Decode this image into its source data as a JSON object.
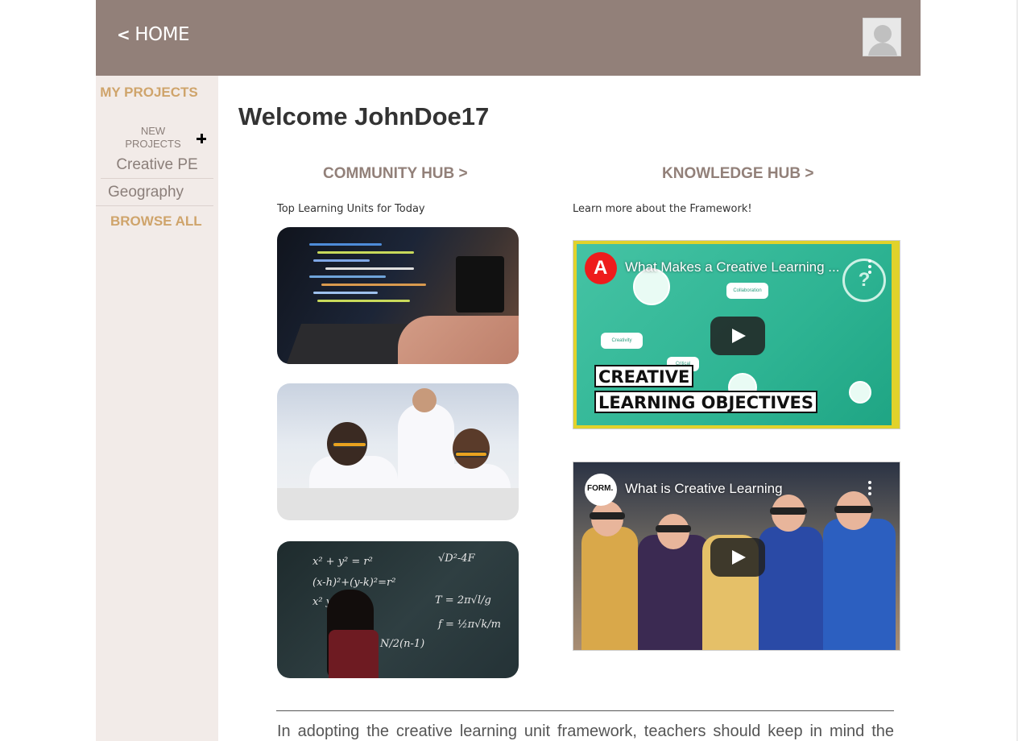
{
  "header": {
    "home_label": "HOME",
    "avatar_alt": "user avatar"
  },
  "sidebar": {
    "my_projects": "MY PROJECTS",
    "new_projects": "NEW PROJECTS",
    "items": [
      {
        "label": "Creative PE"
      },
      {
        "label": "Geography"
      }
    ],
    "browse_all": "BROWSE ALL"
  },
  "main": {
    "welcome": "Welcome JohnDoe17",
    "community_hub": {
      "title": "COMMUNITY HUB >",
      "subtitle": "Top Learning Units for Today",
      "cards": [
        {
          "image": "laptop-coding-photo"
        },
        {
          "image": "science-lab-students-photo"
        },
        {
          "image": "chalkboard-math-photo"
        }
      ]
    },
    "knowledge_hub": {
      "title": "KNOWLEDGE HUB >",
      "subtitle": "Learn more about the Framework!",
      "videos": [
        {
          "title": "What Makes a Creative Learning ...",
          "channel": "Adobe",
          "thumbnail_text_1": "CREATIVE",
          "thumbnail_text_2": "LEARNING OBJECTIVES",
          "thumbnail_labels": [
            "Collaboration",
            "Creativity",
            "Critical"
          ]
        },
        {
          "title": "What is Creative Learning",
          "channel": "FORM."
        }
      ]
    },
    "intro_text": "In adopting the creative learning unit framework, teachers should keep in mind the"
  },
  "colors": {
    "header_bg": "#928079",
    "sidebar_bg": "#f2ebe8",
    "accent_gold": "#cfa46b",
    "muted_text": "#8b7f7a",
    "hub_title": "#928079"
  }
}
